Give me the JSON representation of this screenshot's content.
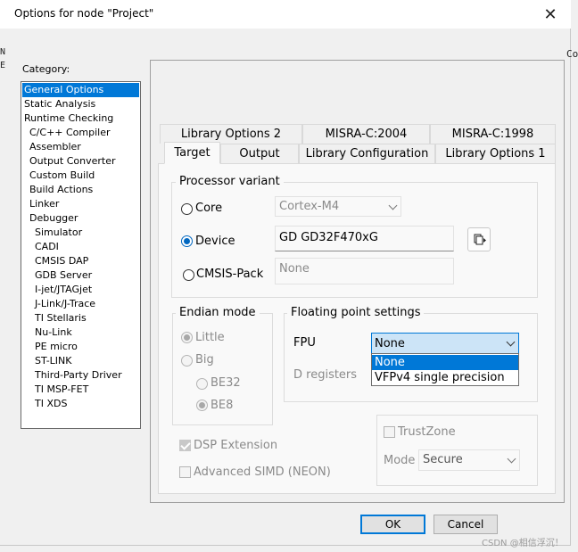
{
  "window": {
    "title": "Options for node \"Project\"",
    "close_glyph": "✕"
  },
  "background_fragments": {
    "left": [
      "N",
      "E"
    ],
    "right": "Co"
  },
  "category": {
    "label": "Category:",
    "items": [
      {
        "label": "General Options",
        "selected": true
      },
      {
        "label": "Static Analysis"
      },
      {
        "label": "Runtime Checking"
      },
      {
        "label": "C/C++ Compiler"
      },
      {
        "label": "Assembler"
      },
      {
        "label": "Output Converter"
      },
      {
        "label": "Custom Build"
      },
      {
        "label": "Build Actions"
      },
      {
        "label": "Linker"
      },
      {
        "label": "Debugger"
      },
      {
        "label": "Simulator"
      },
      {
        "label": "CADI"
      },
      {
        "label": "CMSIS DAP"
      },
      {
        "label": "GDB Server"
      },
      {
        "label": "I-jet/JTAGjet"
      },
      {
        "label": "J-Link/J-Trace"
      },
      {
        "label": "TI Stellaris"
      },
      {
        "label": "Nu-Link"
      },
      {
        "label": "PE micro"
      },
      {
        "label": "ST-LINK"
      },
      {
        "label": "Third-Party Driver"
      },
      {
        "label": "TI MSP-FET"
      },
      {
        "label": "TI XDS"
      }
    ]
  },
  "tabs": {
    "row1": [
      "Library Options 2",
      "MISRA-C:2004",
      "MISRA-C:1998"
    ],
    "row2": [
      "Target",
      "Output",
      "Library Configuration",
      "Library Options 1"
    ],
    "active": "Target"
  },
  "processor_variant": {
    "title": "Processor variant",
    "core_label": "Core",
    "core_value": "Cortex-M4",
    "device_label": "Device",
    "device_value": "GD GD32F470xG",
    "cmsis_label": "CMSIS-Pack",
    "cmsis_value": "None",
    "selected": "Device"
  },
  "endian": {
    "title": "Endian mode",
    "little": "Little",
    "big": "Big",
    "be32": "BE32",
    "be8": "BE8"
  },
  "fp": {
    "title": "Floating point settings",
    "fpu_label": "FPU",
    "fpu_value": "None",
    "dregs_label": "D registers",
    "options": [
      "None",
      "VFPv4 single precision"
    ]
  },
  "checks": {
    "dsp": "DSP Extension",
    "simd": "Advanced SIMD (NEON)"
  },
  "trustzone": {
    "label": "TrustZone",
    "mode_label": "Mode",
    "mode_value": "Secure"
  },
  "buttons": {
    "ok": "OK",
    "cancel": "Cancel"
  },
  "watermark": "CSDN @相信浮沉！",
  "colors": {
    "accent": "#0078d7",
    "selection": "#0078d7"
  }
}
